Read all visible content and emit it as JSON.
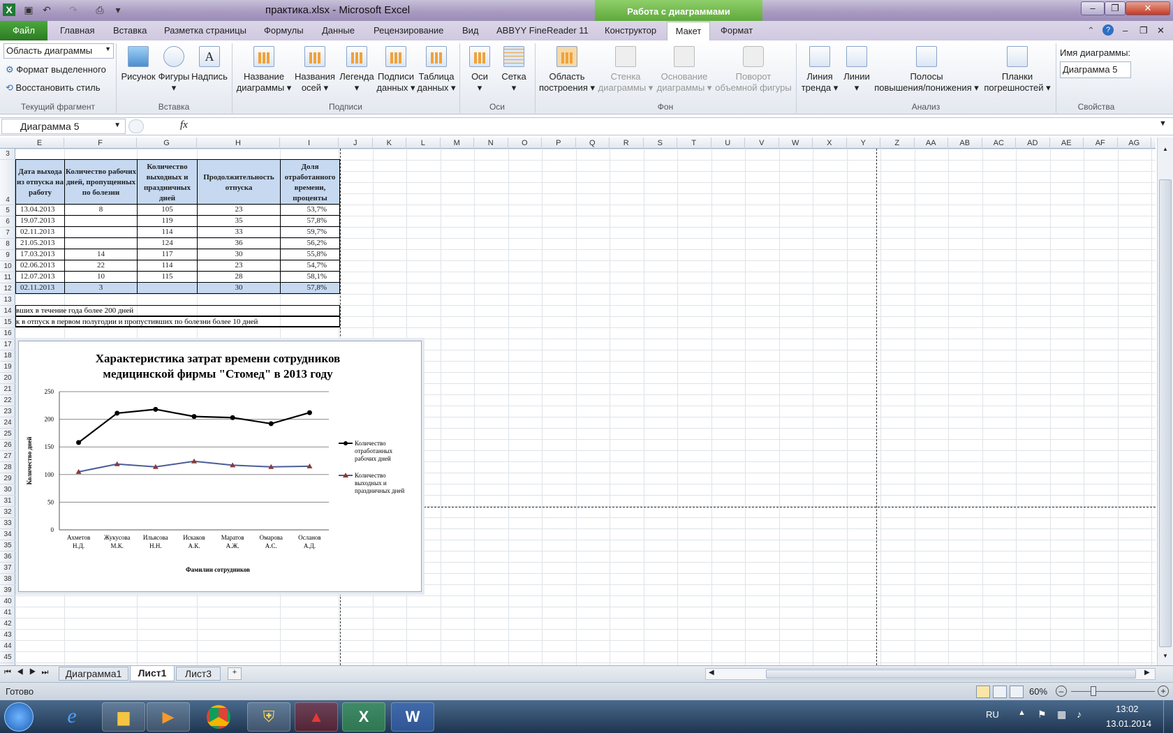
{
  "window": {
    "title": "практика.xlsx  -  Microsoft Excel",
    "context_header": "Работа с диаграммами"
  },
  "tabs": [
    "Файл",
    "Главная",
    "Вставка",
    "Разметка страницы",
    "Формулы",
    "Данные",
    "Рецензирование",
    "Вид",
    "ABBYY FineReader 11",
    "Конструктор",
    "Макет",
    "Формат"
  ],
  "ribbon": {
    "fragment_select": "Область диаграммы",
    "format_selected": "Формат выделенного",
    "restore_style": "Восстановить стиль",
    "g_current": "Текущий фрагмент",
    "picture": "Рисунок",
    "shapes": "Фигуры",
    "textbox": "Надпись",
    "g_insert": "Вставка",
    "chart_title_l1": "Название",
    "chart_title_l2": "диаграммы",
    "axis_titles_l1": "Названия",
    "axis_titles_l2": "осей",
    "legend": "Легенда",
    "data_labels_l1": "Подписи",
    "data_labels_l2": "данных",
    "data_table_l1": "Таблица",
    "data_table_l2": "данных",
    "g_labels": "Подписи",
    "axes": "Оси",
    "gridlines": "Сетка",
    "g_axes": "Оси",
    "plot_area_l1": "Область",
    "plot_area_l2": "построения",
    "chart_wall_l1": "Стенка",
    "chart_wall_l2": "диаграммы",
    "chart_floor_l1": "Основание",
    "chart_floor_l2": "диаграммы",
    "rotation_l1": "Поворот",
    "rotation_l2": "объемной фигуры",
    "g_background": "Фон",
    "trendline_l1": "Линия",
    "trendline_l2": "тренда",
    "lines": "Линии",
    "updown_l1": "Полосы",
    "updown_l2": "повышения/понижения",
    "errorbars_l1": "Планки",
    "errorbars_l2": "погрешностей",
    "g_analysis": "Анализ",
    "chart_name_label": "Имя диаграммы:",
    "chart_name_value": "Диаграмма 5",
    "g_properties": "Свойства"
  },
  "formula": {
    "namebox": "Диаграмма 5",
    "fx": "fx"
  },
  "columns": [
    "E",
    "F",
    "G",
    "H",
    "I",
    "J",
    "K",
    "L",
    "M",
    "N",
    "O",
    "P",
    "Q",
    "R",
    "S",
    "T",
    "U",
    "V",
    "W",
    "X",
    "Y",
    "Z",
    "AA",
    "AB",
    "AC",
    "AD",
    "AE",
    "AF",
    "AG"
  ],
  "rows": [
    "3",
    "4",
    "5",
    "6",
    "7",
    "8",
    "9",
    "10",
    "11",
    "12",
    "13",
    "14",
    "15",
    "16",
    "17",
    "18",
    "19",
    "20",
    "21",
    "22",
    "23",
    "24",
    "25",
    "26",
    "27",
    "28",
    "29",
    "30",
    "31",
    "32",
    "33",
    "34",
    "35",
    "36",
    "37",
    "38",
    "39",
    "40",
    "41",
    "42",
    "43",
    "44",
    "45"
  ],
  "table": {
    "headers": [
      "Дата выхода из отпуска на работу",
      "Количество рабочих дней, пропущенных по болезни",
      "Количество выходных и праздничных дней",
      "Продолжительность отпуска",
      "Доля отработанного времени, проценты"
    ],
    "rows": [
      [
        "13.04.2013",
        "8",
        "105",
        "23",
        "53,7%"
      ],
      [
        "19.07.2013",
        "",
        "119",
        "35",
        "57,8%"
      ],
      [
        "02.11.2013",
        "",
        "114",
        "33",
        "59,7%"
      ],
      [
        "21.05.2013",
        "",
        "124",
        "36",
        "56,2%"
      ],
      [
        "17.03.2013",
        "14",
        "117",
        "30",
        "55,8%"
      ],
      [
        "02.06.2013",
        "22",
        "114",
        "23",
        "54,7%"
      ],
      [
        "12.07.2013",
        "10",
        "115",
        "28",
        "58,1%"
      ],
      [
        "02.11.2013",
        "3",
        "",
        "30",
        "57,8%"
      ]
    ],
    "note14": "вших в течение года более 200 дней",
    "note15": "к в отпуск в первом полугодии и пропустивших по болезни более 10 дней"
  },
  "chart_data": {
    "type": "line",
    "title": "Характеристика затрат времени сотрудников медицинской фирмы \"Стомед\" в 2013 году",
    "title_l1": "Характеристика затрат времени сотрудников",
    "title_l2": "медицинской фирмы \"Стомед\" в 2013 году",
    "xlabel": "Фамилии сотрудников",
    "ylabel": "Количество дней",
    "ylim": [
      0,
      250
    ],
    "yticks": [
      0,
      50,
      100,
      150,
      200,
      250
    ],
    "categories": [
      [
        "Ахметов",
        "Н.Д."
      ],
      [
        "Жукусова",
        "М.К."
      ],
      [
        "Ильясова",
        "Н.Н."
      ],
      [
        "Искаков",
        "А.К."
      ],
      [
        "Маратов",
        "А.Ж."
      ],
      [
        "Омарова",
        "А.С."
      ],
      [
        "Осланов",
        "А.Д."
      ]
    ],
    "series": [
      {
        "name": "Количество отработанных рабочих дней",
        "legend_lines": [
          "Количество",
          "отработанных",
          "рабочих дней"
        ],
        "values": [
          158,
          211,
          218,
          205,
          203,
          192,
          212
        ],
        "color": "#000000",
        "marker": "circle"
      },
      {
        "name": "Количество выходных и праздничных дней",
        "legend_lines": [
          "Количество",
          "выходных и",
          "праздничных  дней"
        ],
        "values": [
          105,
          119,
          114,
          124,
          117,
          114,
          115
        ],
        "color": "#4a5d96",
        "marker": "triangle",
        "marker_color": "#8a3a3a"
      }
    ],
    "grid": "horizontal",
    "legend": "right"
  },
  "sheets": [
    "Диаграмма1",
    "Лист1",
    "Лист3"
  ],
  "status": {
    "ready": "Готово",
    "zoom": "60%"
  },
  "taskbar": {
    "lang": "RU",
    "time": "13:02",
    "date": "13.01.2014"
  }
}
